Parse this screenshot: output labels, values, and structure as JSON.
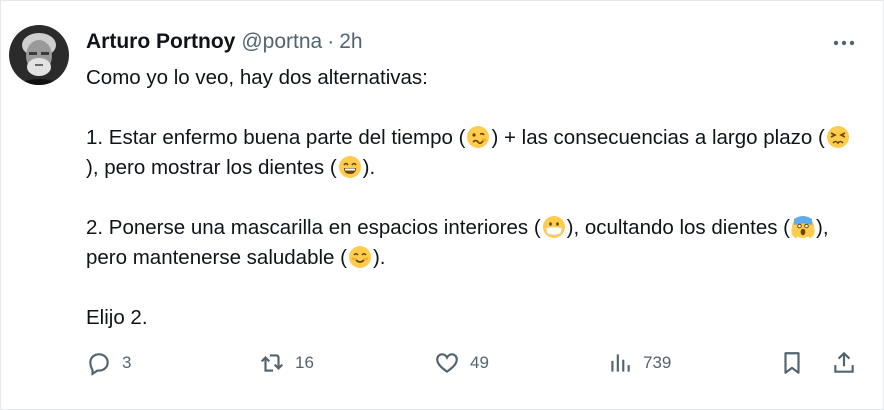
{
  "author": {
    "name": "Arturo Portnoy",
    "handle": "@portna",
    "separator": "·",
    "time": "2h"
  },
  "tweet": {
    "line1": "Como yo lo veo, hay dos alternativas:",
    "p1_a": "1. Estar enfermo buena parte del tiempo (",
    "p1_b": ") + las consecuencias a largo plazo (",
    "p1_c": "), pero mostrar los dientes (",
    "p1_d": ").",
    "p2_a": "2. Ponerse una mascarilla en espacios interiores (",
    "p2_b": "), ocultando los dientes (",
    "p2_c": "), pero mantenerse saludable (",
    "p2_d": ").",
    "closing": "Elijo 2.",
    "emojis": [
      "woozy-face",
      "tired-face",
      "grinning-face",
      "mask-face",
      "screaming-face",
      "smiling-face"
    ]
  },
  "actions": {
    "replies": "3",
    "retweets": "16",
    "likes": "49",
    "views": "739"
  },
  "icons": [
    "more-icon",
    "reply-icon",
    "retweet-icon",
    "like-icon",
    "views-icon",
    "bookmark-icon",
    "share-icon"
  ],
  "colors": {
    "text": "#0f1419",
    "secondary": "#536471",
    "emoji_yellow": "#ffcc4d"
  }
}
